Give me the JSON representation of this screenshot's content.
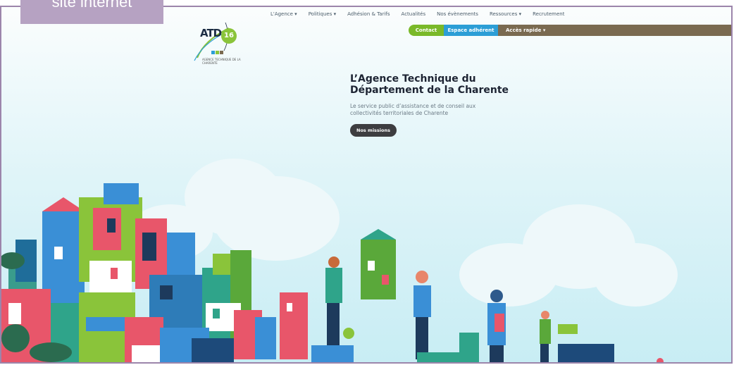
{
  "caption": "site internet",
  "logo": {
    "acronym": "ATD",
    "number": "16",
    "tagline": "AGENCE TECHNIQUE DE LA CHARENTE"
  },
  "nav": {
    "items": [
      {
        "label": "L'Agence ▾"
      },
      {
        "label": "Politiques ▾"
      },
      {
        "label": "Adhésion & Tarifs"
      },
      {
        "label": "Actualités"
      },
      {
        "label": "Nos évènements"
      },
      {
        "label": "Ressources ▾"
      },
      {
        "label": "Recrutement"
      }
    ]
  },
  "utility_bar": {
    "contact": "Contact",
    "espace": "Espace adhérent",
    "acces": "Accès rapide ▾"
  },
  "hero": {
    "title": "L’Agence Technique du Département de la Charente",
    "subtitle": "Le service public d’assistance et de conseil aux collectivités territoriales de Charente",
    "cta": "Nos missions"
  },
  "colors": {
    "frame": "#9c85ab",
    "caption_bg": "#b6a2c2",
    "contact": "#7ab929",
    "espace": "#2c9ed6",
    "acces": "#7a6a50"
  }
}
